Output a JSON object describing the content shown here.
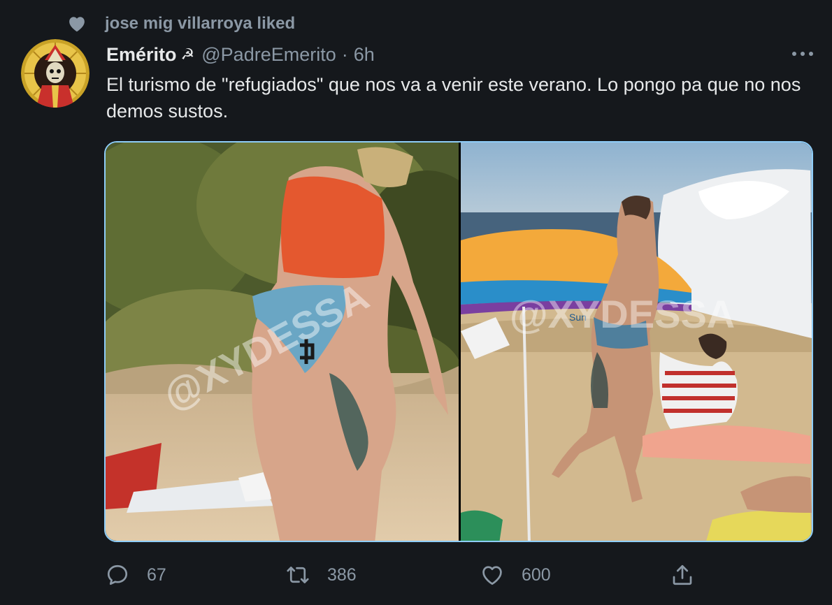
{
  "social_context": {
    "text": "jose mig villarroya liked",
    "icon": "heart-icon"
  },
  "author": {
    "display_name": "Emérito",
    "emoji": "☭",
    "handle": "@PadreEmerito",
    "separator": "·",
    "time": "6h"
  },
  "tweet": {
    "text": "El turismo de \"refugiados\" que nos va a venir este verano. Lo pongo pa que no nos demos sustos."
  },
  "media": {
    "photo_count": 2,
    "watermark": "@XYDESSA",
    "right_photo_umbrella_print": "Sun"
  },
  "actions": {
    "reply": {
      "icon": "reply-icon",
      "count": "67"
    },
    "retweet": {
      "icon": "retweet-icon",
      "count": "386"
    },
    "like": {
      "icon": "heart-outline-icon",
      "count": "600"
    },
    "share": {
      "icon": "share-icon"
    }
  },
  "colors": {
    "background": "#15181c",
    "text_primary": "#e7e9ea",
    "text_secondary": "#8b98a5",
    "media_focus_border": "#8ecdf8"
  }
}
